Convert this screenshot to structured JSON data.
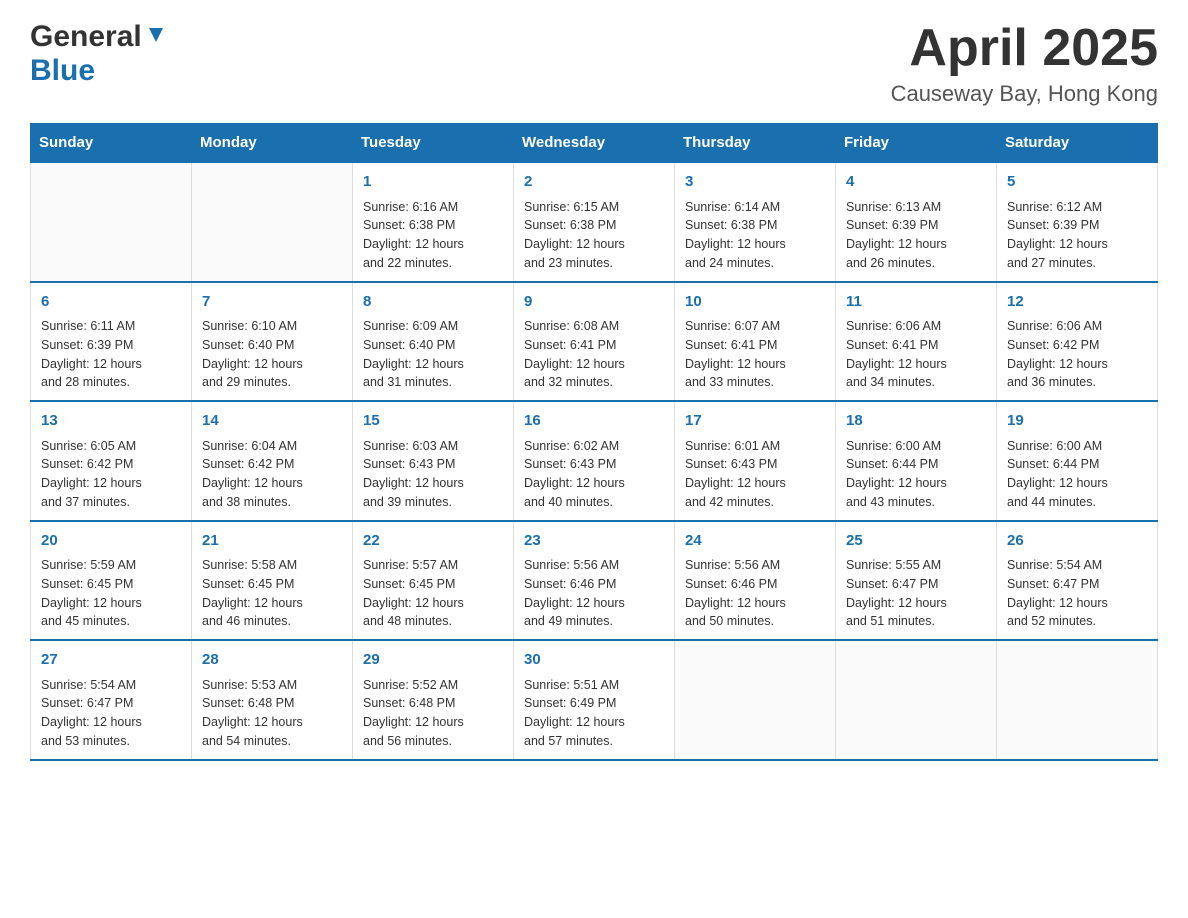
{
  "header": {
    "logo_general": "General",
    "logo_blue": "Blue",
    "month_title": "April 2025",
    "location": "Causeway Bay, Hong Kong"
  },
  "weekdays": [
    "Sunday",
    "Monday",
    "Tuesday",
    "Wednesday",
    "Thursday",
    "Friday",
    "Saturday"
  ],
  "weeks": [
    [
      {
        "day": "",
        "info": ""
      },
      {
        "day": "",
        "info": ""
      },
      {
        "day": "1",
        "info": "Sunrise: 6:16 AM\nSunset: 6:38 PM\nDaylight: 12 hours\nand 22 minutes."
      },
      {
        "day": "2",
        "info": "Sunrise: 6:15 AM\nSunset: 6:38 PM\nDaylight: 12 hours\nand 23 minutes."
      },
      {
        "day": "3",
        "info": "Sunrise: 6:14 AM\nSunset: 6:38 PM\nDaylight: 12 hours\nand 24 minutes."
      },
      {
        "day": "4",
        "info": "Sunrise: 6:13 AM\nSunset: 6:39 PM\nDaylight: 12 hours\nand 26 minutes."
      },
      {
        "day": "5",
        "info": "Sunrise: 6:12 AM\nSunset: 6:39 PM\nDaylight: 12 hours\nand 27 minutes."
      }
    ],
    [
      {
        "day": "6",
        "info": "Sunrise: 6:11 AM\nSunset: 6:39 PM\nDaylight: 12 hours\nand 28 minutes."
      },
      {
        "day": "7",
        "info": "Sunrise: 6:10 AM\nSunset: 6:40 PM\nDaylight: 12 hours\nand 29 minutes."
      },
      {
        "day": "8",
        "info": "Sunrise: 6:09 AM\nSunset: 6:40 PM\nDaylight: 12 hours\nand 31 minutes."
      },
      {
        "day": "9",
        "info": "Sunrise: 6:08 AM\nSunset: 6:41 PM\nDaylight: 12 hours\nand 32 minutes."
      },
      {
        "day": "10",
        "info": "Sunrise: 6:07 AM\nSunset: 6:41 PM\nDaylight: 12 hours\nand 33 minutes."
      },
      {
        "day": "11",
        "info": "Sunrise: 6:06 AM\nSunset: 6:41 PM\nDaylight: 12 hours\nand 34 minutes."
      },
      {
        "day": "12",
        "info": "Sunrise: 6:06 AM\nSunset: 6:42 PM\nDaylight: 12 hours\nand 36 minutes."
      }
    ],
    [
      {
        "day": "13",
        "info": "Sunrise: 6:05 AM\nSunset: 6:42 PM\nDaylight: 12 hours\nand 37 minutes."
      },
      {
        "day": "14",
        "info": "Sunrise: 6:04 AM\nSunset: 6:42 PM\nDaylight: 12 hours\nand 38 minutes."
      },
      {
        "day": "15",
        "info": "Sunrise: 6:03 AM\nSunset: 6:43 PM\nDaylight: 12 hours\nand 39 minutes."
      },
      {
        "day": "16",
        "info": "Sunrise: 6:02 AM\nSunset: 6:43 PM\nDaylight: 12 hours\nand 40 minutes."
      },
      {
        "day": "17",
        "info": "Sunrise: 6:01 AM\nSunset: 6:43 PM\nDaylight: 12 hours\nand 42 minutes."
      },
      {
        "day": "18",
        "info": "Sunrise: 6:00 AM\nSunset: 6:44 PM\nDaylight: 12 hours\nand 43 minutes."
      },
      {
        "day": "19",
        "info": "Sunrise: 6:00 AM\nSunset: 6:44 PM\nDaylight: 12 hours\nand 44 minutes."
      }
    ],
    [
      {
        "day": "20",
        "info": "Sunrise: 5:59 AM\nSunset: 6:45 PM\nDaylight: 12 hours\nand 45 minutes."
      },
      {
        "day": "21",
        "info": "Sunrise: 5:58 AM\nSunset: 6:45 PM\nDaylight: 12 hours\nand 46 minutes."
      },
      {
        "day": "22",
        "info": "Sunrise: 5:57 AM\nSunset: 6:45 PM\nDaylight: 12 hours\nand 48 minutes."
      },
      {
        "day": "23",
        "info": "Sunrise: 5:56 AM\nSunset: 6:46 PM\nDaylight: 12 hours\nand 49 minutes."
      },
      {
        "day": "24",
        "info": "Sunrise: 5:56 AM\nSunset: 6:46 PM\nDaylight: 12 hours\nand 50 minutes."
      },
      {
        "day": "25",
        "info": "Sunrise: 5:55 AM\nSunset: 6:47 PM\nDaylight: 12 hours\nand 51 minutes."
      },
      {
        "day": "26",
        "info": "Sunrise: 5:54 AM\nSunset: 6:47 PM\nDaylight: 12 hours\nand 52 minutes."
      }
    ],
    [
      {
        "day": "27",
        "info": "Sunrise: 5:54 AM\nSunset: 6:47 PM\nDaylight: 12 hours\nand 53 minutes."
      },
      {
        "day": "28",
        "info": "Sunrise: 5:53 AM\nSunset: 6:48 PM\nDaylight: 12 hours\nand 54 minutes."
      },
      {
        "day": "29",
        "info": "Sunrise: 5:52 AM\nSunset: 6:48 PM\nDaylight: 12 hours\nand 56 minutes."
      },
      {
        "day": "30",
        "info": "Sunrise: 5:51 AM\nSunset: 6:49 PM\nDaylight: 12 hours\nand 57 minutes."
      },
      {
        "day": "",
        "info": ""
      },
      {
        "day": "",
        "info": ""
      },
      {
        "day": "",
        "info": ""
      }
    ]
  ]
}
